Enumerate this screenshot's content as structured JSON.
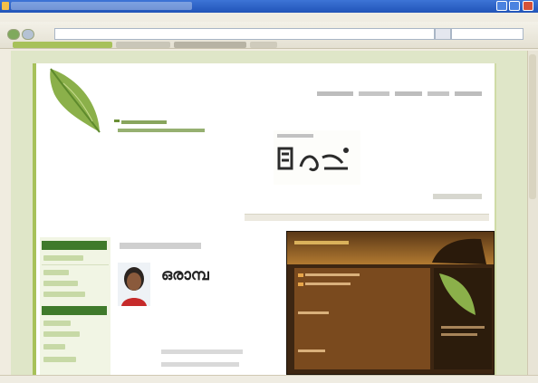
{
  "window": {
    "title": ""
  },
  "menubar": {
    "items": [
      "",
      "",
      "",
      "",
      "",
      ""
    ]
  },
  "toolbar": {
    "address": "",
    "search_placeholder": ""
  },
  "page": {
    "profile_name": "ഒരാമ്പ",
    "sidebar_sections": 3,
    "accent_color": "#a7c15a",
    "sidebar_header_color": "#3f7a2b",
    "embedded_screenshot_color": "#3d2612"
  }
}
